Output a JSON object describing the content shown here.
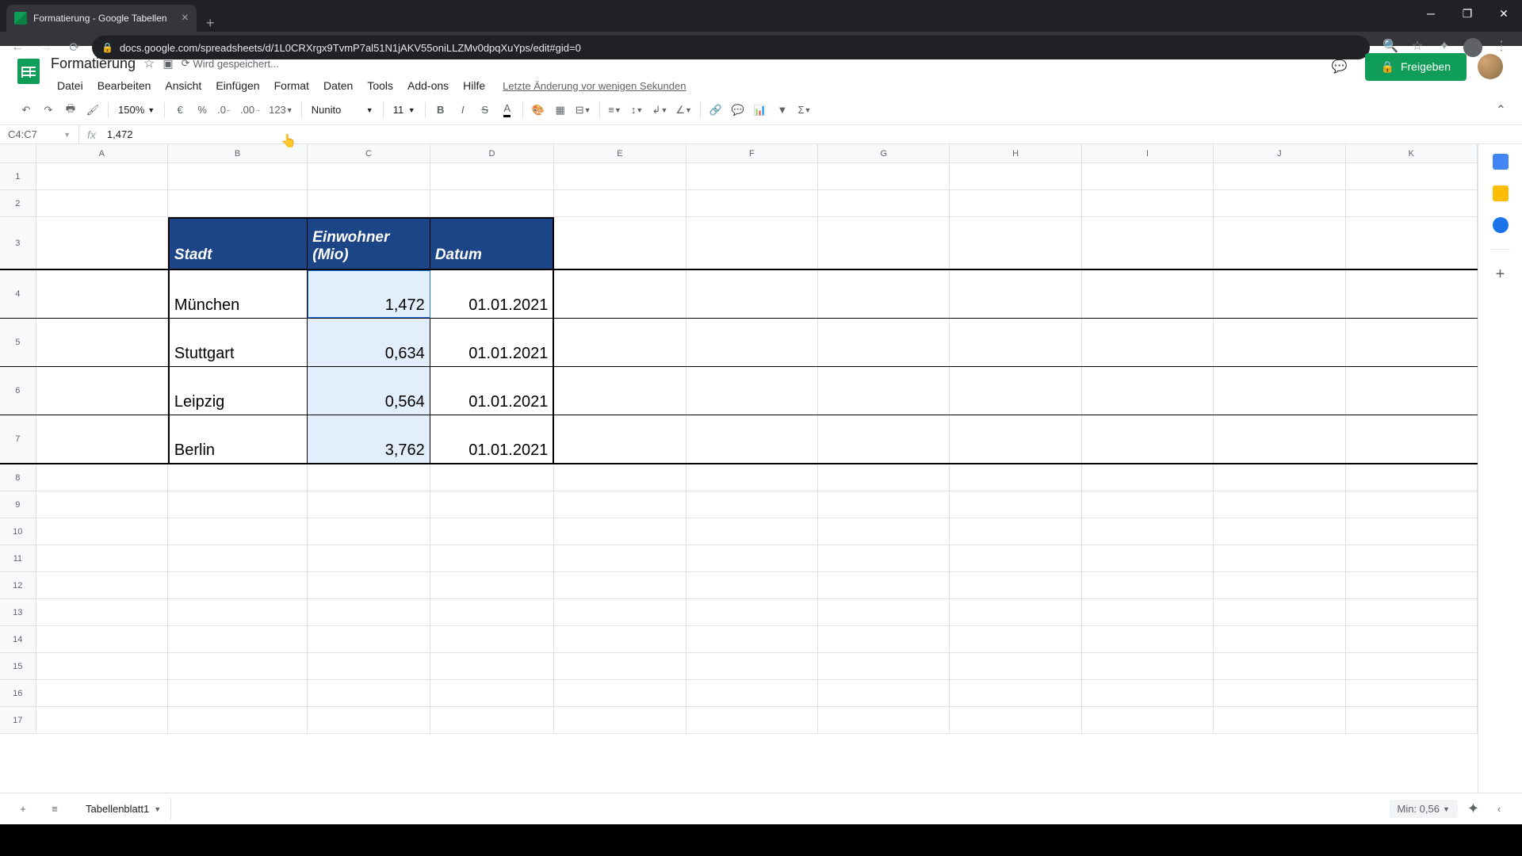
{
  "browser": {
    "tab_title": "Formatierung - Google Tabellen",
    "url": "docs.google.com/spreadsheets/d/1L0CRXrgx9TvmP7al51N1jAKV55oniLLZMv0dpqXuYps/edit#gid=0"
  },
  "doc": {
    "title": "Formatierung",
    "save_status": "Wird gespeichert...",
    "last_edit": "Letzte Änderung vor wenigen Sekunden"
  },
  "menus": [
    "Datei",
    "Bearbeiten",
    "Ansicht",
    "Einfügen",
    "Format",
    "Daten",
    "Tools",
    "Add-ons",
    "Hilfe"
  ],
  "toolbar": {
    "zoom": "150%",
    "currency": "€",
    "percent": "%",
    "dec_less": ".0",
    "dec_more": ".00",
    "more_formats": "123",
    "font": "Nunito",
    "font_size": "11"
  },
  "share_label": "Freigeben",
  "name_box": "C4:C7",
  "formula_value": "1,472",
  "columns": [
    "A",
    "B",
    "C",
    "D",
    "E",
    "F",
    "G",
    "H",
    "I",
    "J",
    "K"
  ],
  "table": {
    "headers": {
      "B": "Stadt",
      "C": "Einwohner (Mio)",
      "D": "Datum"
    },
    "rows": [
      {
        "city": "München",
        "pop": "1,472",
        "date": "01.01.2021"
      },
      {
        "city": "Stuttgart",
        "pop": "0,634",
        "date": "01.01.2021"
      },
      {
        "city": "Leipzig",
        "pop": "0,564",
        "date": "01.01.2021"
      },
      {
        "city": "Berlin",
        "pop": "3,762",
        "date": "01.01.2021"
      }
    ]
  },
  "sheet_tab": "Tabellenblatt1",
  "status_min": "Min: 0,56"
}
